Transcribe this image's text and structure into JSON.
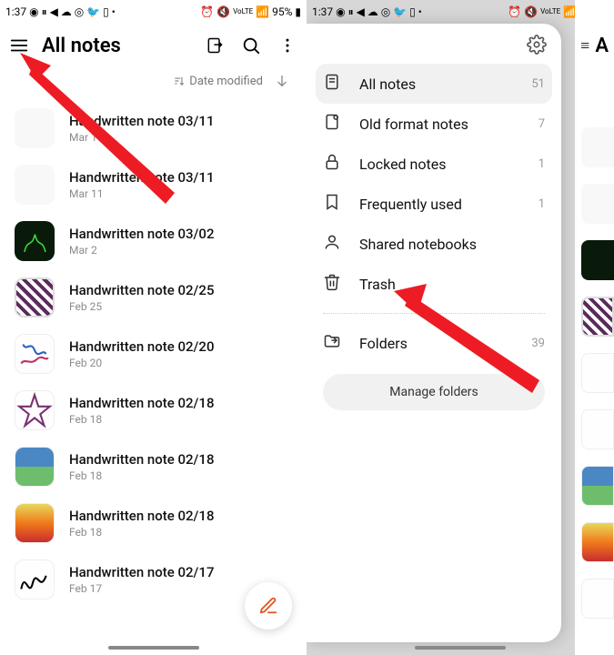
{
  "status": {
    "time": "1:37",
    "battery_pct": "95%"
  },
  "left": {
    "title": "All notes",
    "sort_label": "Date modified",
    "notes": [
      {
        "title": "Handwritten note 03/11",
        "date": "Mar 11"
      },
      {
        "title": "Handwritten note 03/11",
        "date": "Mar 11"
      },
      {
        "title": "Handwritten note 03/02",
        "date": "Mar 2"
      },
      {
        "title": "Handwritten note 02/25",
        "date": "Feb 25"
      },
      {
        "title": "Handwritten note 02/20",
        "date": "Feb 20"
      },
      {
        "title": "Handwritten note 02/18",
        "date": "Feb 18"
      },
      {
        "title": "Handwritten note 02/18",
        "date": "Feb 18"
      },
      {
        "title": "Handwritten note 02/18",
        "date": "Feb 18"
      },
      {
        "title": "Handwritten note 02/17",
        "date": "Feb 17"
      }
    ]
  },
  "right": {
    "sliver_title": "A",
    "drawer": {
      "items": [
        {
          "label": "All notes",
          "count": "51"
        },
        {
          "label": "Old format notes",
          "count": "7"
        },
        {
          "label": "Locked notes",
          "count": "1"
        },
        {
          "label": "Frequently used",
          "count": "1"
        },
        {
          "label": "Shared notebooks",
          "count": ""
        },
        {
          "label": "Trash",
          "count": ""
        }
      ],
      "folders_label": "Folders",
      "folders_count": "39",
      "manage_label": "Manage folders"
    }
  }
}
